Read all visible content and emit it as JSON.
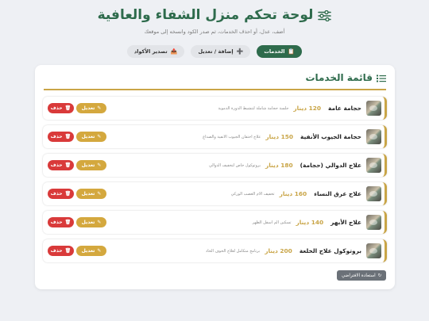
{
  "header": {
    "title": "لوحة تحكم منزل الشفاء والعافية",
    "subtitle": "أضف، عدل، أو احذف الخدمات، ثم صدر الكود وانسخه إلى موقعك"
  },
  "tabs": [
    {
      "label": "الخدمات",
      "icon": "clipboard-icon",
      "active": true
    },
    {
      "label": "إضافة / تعديل",
      "icon": "plus-icon",
      "active": false
    },
    {
      "label": "تصدير الأكواد",
      "icon": "export-icon",
      "active": false
    }
  ],
  "list": {
    "title": "قائمة الخدمات"
  },
  "services": [
    {
      "name": "حجامة عامة",
      "price": "120 دينار",
      "description": "جلسة حجامة شاملة لتنشيط الدورة الدموية"
    },
    {
      "name": "حجامة الجيوب الأنفية",
      "price": "150 دينار",
      "description": "علاج احتقان الجيوب الأنفية والصداع"
    },
    {
      "name": "علاج الدوالي (حجامة)",
      "price": "180 دينار",
      "description": "بروتوكول خاص لتخفيف الدوالي"
    },
    {
      "name": "علاج عرق النساء",
      "price": "160 دينار",
      "description": "تخفيف آلام العصب الوركي"
    },
    {
      "name": "علاج الأبهر",
      "price": "140 دينار",
      "description": "تسكين ألم أسفل الظهر"
    },
    {
      "name": "بروتوكول علاج الخلعة",
      "price": "200 دينار",
      "description": "برنامج متكامل لعلاج الخوف الحاد"
    }
  ],
  "actions": {
    "edit_label": "تعديل",
    "delete_label": "حذف",
    "restore_label": "استعادة الافتراضي"
  },
  "colors": {
    "brand_green": "#2e6b4c",
    "gold": "#c9a547",
    "danger": "#d93a3a",
    "background": "#eef0f4"
  }
}
